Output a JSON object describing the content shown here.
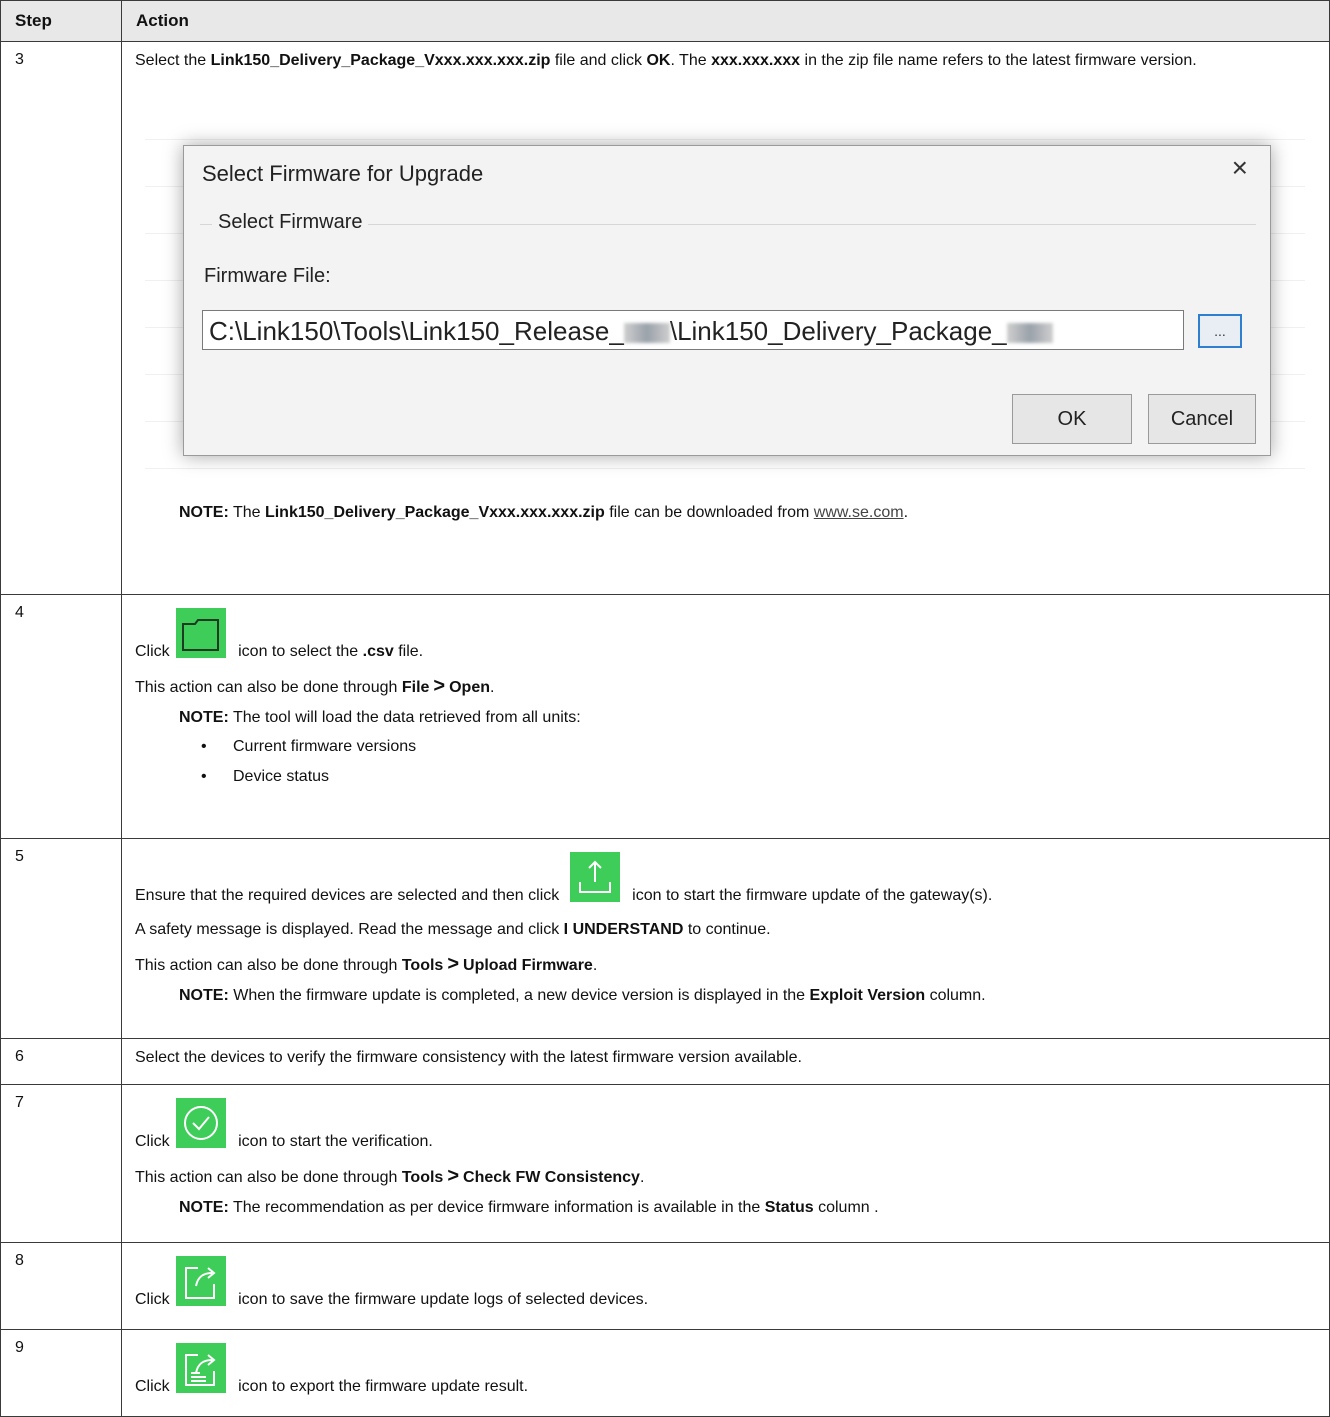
{
  "header": {
    "step": "Step",
    "action": "Action"
  },
  "row3": {
    "num": "3",
    "t1": "Select the ",
    "b1": "Link150_Delivery_Package_Vxxx.xxx.xxx.zip",
    "t2": " file and click ",
    "b2": "OK",
    "t3": ". The ",
    "b3": "xxx.xxx.xxx",
    "t4": " in the zip file name refers to the latest firmware version.",
    "dialog": {
      "title": "Select Firmware for Upgrade",
      "close": "×",
      "group": "Select Firmware",
      "field_label": "Firmware File:",
      "path_a": "C:\\Link150\\Tools\\Link150_Release_",
      "path_b": "\\Link150_Delivery_Package_",
      "browse": "...",
      "ok": "OK",
      "cancel": "Cancel"
    },
    "note_label": "NOTE:",
    "note_t1": " The ",
    "note_b1": "Link150_Delivery_Package_Vxxx.xxx.xxx.zip",
    "note_t2": " file can be downloaded from ",
    "note_link": "www.se.com",
    "note_t3": "."
  },
  "row4": {
    "num": "4",
    "click": "Click",
    "t1": " icon to select the ",
    "b1": ".csv",
    "t2": " file.",
    "p2_t": "This action can also be done through ",
    "p2_b1": "File",
    "arrow": ">",
    "p2_b2": "Open",
    "p2_end": ".",
    "note_label": "NOTE:",
    "note_text": " The tool will load the data retrieved from all units:",
    "bullets": [
      "Current firmware versions",
      "Device status"
    ],
    "icon": "folder-icon"
  },
  "row5": {
    "num": "5",
    "t1": "Ensure that the required devices are selected and then click ",
    "t2": " icon to start the firmware update of the gateway(s).",
    "p2_t1": "A safety message is displayed. Read the message and click ",
    "p2_b": "I UNDERSTAND",
    "p2_t2": " to continue.",
    "p3_t": "This action can also be done through ",
    "p3_b1": "Tools",
    "arrow": ">",
    "p3_b2": "Upload Firmware",
    "p3_end": ".",
    "note_label": "NOTE:",
    "note_t1": " When the firmware update is completed, a new device version is displayed in the ",
    "note_b": "Exploit Version",
    "note_t2": " column.",
    "icon": "upload-icon"
  },
  "row6": {
    "num": "6",
    "text": "Select the devices to verify the firmware consistency with the latest firmware version available."
  },
  "row7": {
    "num": "7",
    "click": "Click",
    "t1": " icon to start the verification.",
    "p2_t": "This action can also be done through ",
    "p2_b1": "Tools",
    "arrow": ">",
    "p2_b2": "Check FW Consistency",
    "p2_end": ".",
    "note_label": "NOTE:",
    "note_t1": " The recommendation as per device firmware information is available in the ",
    "note_b": "Status",
    "note_t2": " column .",
    "icon": "check-circle-icon"
  },
  "row8": {
    "num": "8",
    "click": "Click",
    "t1": " icon to save the firmware update logs of selected devices.",
    "icon": "save-log-icon"
  },
  "row9": {
    "num": "9",
    "click": "Click",
    "t1": " icon to export the firmware update result.",
    "icon": "export-icon"
  },
  "colors": {
    "icon_green": "#3dcd58",
    "header_bg": "#e8e8e8",
    "border": "#3a3a3a"
  }
}
